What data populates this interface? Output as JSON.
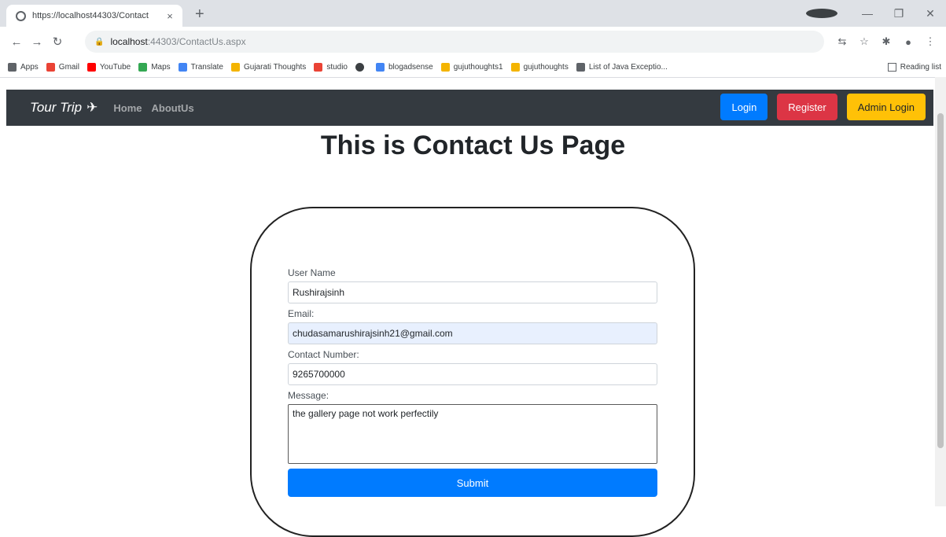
{
  "browser": {
    "tab_title": "https://localhost44303/Contact",
    "tab_close": "×",
    "new_tab": "+",
    "url_host": "localhost",
    "url_path": ":44303/ContactUs.aspx",
    "bookmarks": [
      {
        "label": "Apps",
        "color": "#5f6368"
      },
      {
        "label": "Gmail",
        "color": "#ea4335"
      },
      {
        "label": "YouTube",
        "color": "#ff0000"
      },
      {
        "label": "Maps",
        "color": "#34a853"
      },
      {
        "label": "Translate",
        "color": "#4285f4"
      },
      {
        "label": "Gujarati Thoughts",
        "color": "#f4b400"
      },
      {
        "label": "studio",
        "color": "#ea4335"
      },
      {
        "label": "",
        "color": "#3c4043"
      },
      {
        "label": "blogadsense",
        "color": "#4285f4"
      },
      {
        "label": "gujuthoughts1",
        "color": "#f4b400"
      },
      {
        "label": "gujuthoughts",
        "color": "#f4b400"
      },
      {
        "label": "List of Java Exceptio...",
        "color": "#5f6368"
      }
    ],
    "reading_list": "Reading list"
  },
  "navbar": {
    "brand": "Tour Trip",
    "links": [
      "Home",
      "AboutUs"
    ],
    "login": "Login",
    "register": "Register",
    "admin_login": "Admin Login"
  },
  "page": {
    "title": "This is Contact Us Page"
  },
  "form": {
    "username_label": "User Name",
    "username_value": "Rushirajsinh",
    "email_label": "Email:",
    "email_value": "chudasamarushirajsinh21@gmail.com",
    "contact_label": "Contact Number:",
    "contact_value": "9265700000",
    "message_label": "Message:",
    "message_value": "the gallery page not work perfectily",
    "submit": "Submit"
  }
}
